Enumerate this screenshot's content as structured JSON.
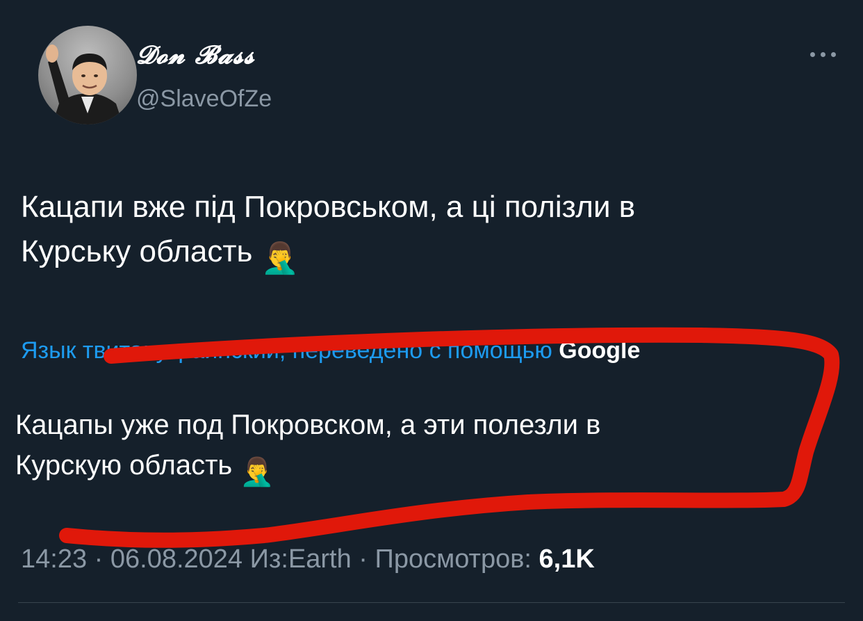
{
  "tweet": {
    "author": {
      "display_name": "𝓓𝓸𝓷 𝓑𝓪𝓼𝓼",
      "handle": "@SlaveOfZe",
      "avatar_icon": "avatar-photo"
    },
    "more_icon": "more-options-icon",
    "text_lines": [
      "Кацапи вже під Покровськом, а ці полізли в",
      "Курську область"
    ],
    "text_emoji": "🤦‍♂️",
    "translation": {
      "notice": "Язык твита: украинский, переведено с помощью ",
      "notice_brand": "Google",
      "lines": [
        "Кацапы уже под Покровском, а эти полезли в",
        "Курскую область"
      ],
      "emoji": "🤦‍♂️"
    },
    "meta": {
      "time": "14:23",
      "separator": " · ",
      "date": "06.08.2024",
      "source": "Из:Earth",
      "views_label": "Просмотров: ",
      "views_count": "6,1K"
    }
  },
  "colors": {
    "background": "#15202b",
    "text_primary": "#ffffff",
    "text_secondary": "#8b98a5",
    "link": "#1d9bf0",
    "annotation_red": "#e0180a"
  }
}
